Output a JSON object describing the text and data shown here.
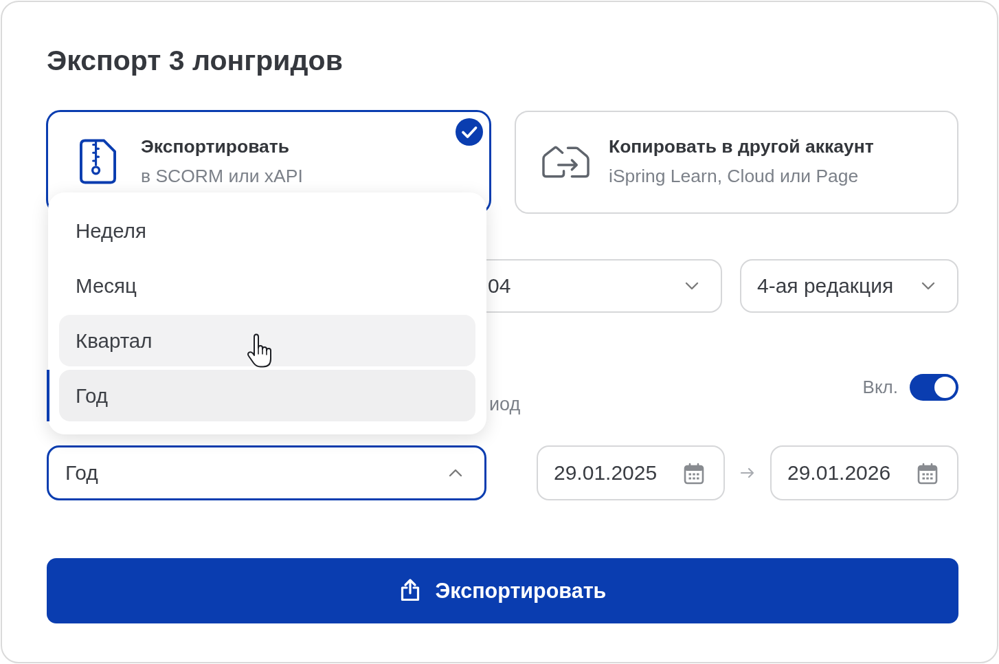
{
  "title": "Экспорт 3 лонгридов",
  "export_options": [
    {
      "kind": "export",
      "title": "Экспортировать",
      "subtitle": "в SCORM или xAPI",
      "selected": true
    },
    {
      "kind": "copy",
      "title": "Копировать в другой аккаунт",
      "subtitle": "iSpring Learn, Cloud или Page",
      "selected": false
    }
  ],
  "selects": [
    {
      "value": "04",
      "expanded": false
    },
    {
      "value": "4-ая редакция",
      "expanded": false
    }
  ],
  "period": {
    "caption": "иод",
    "toggle": {
      "label": "Вкл.",
      "on": true
    },
    "select": {
      "value": "Год",
      "expanded": true,
      "options": [
        {
          "label": "Неделя",
          "selected": false,
          "hovered": false
        },
        {
          "label": "Месяц",
          "selected": false,
          "hovered": false
        },
        {
          "label": "Квартал",
          "selected": false,
          "hovered": true
        },
        {
          "label": "Год",
          "selected": true,
          "hovered": false
        }
      ]
    },
    "date_from": "29.01.2025",
    "date_to": "29.01.2026"
  },
  "export_button": {
    "label": "Экспортировать"
  }
}
